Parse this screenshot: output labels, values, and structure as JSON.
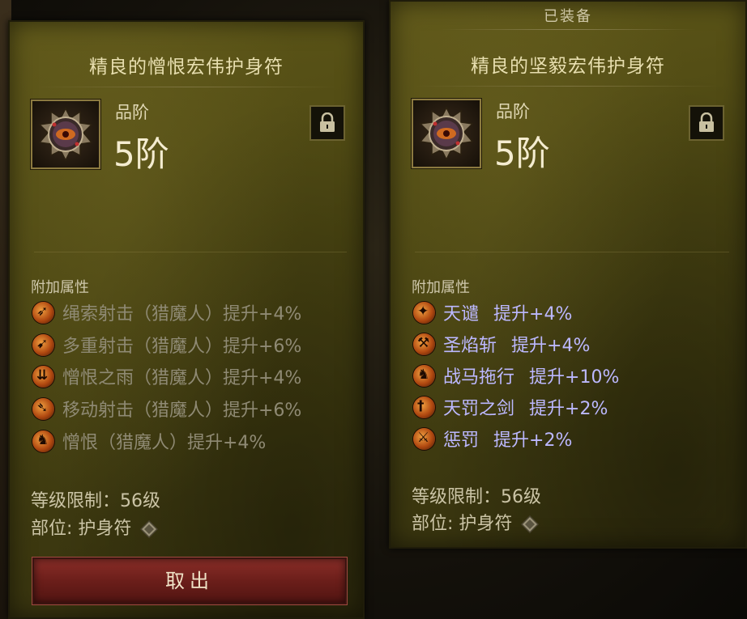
{
  "left_panel": {
    "title": "精良的憎恨宏伟护身符",
    "rank_label": "品阶",
    "rank_value": "5阶",
    "section_title": "附加属性",
    "affixes": [
      {
        "text": "绳索射击（猎魔人）提升+4%",
        "icon": "chakram-arrows-icon"
      },
      {
        "text": "多重射击（猎魔人）提升+6%",
        "icon": "multishot-icon"
      },
      {
        "text": "憎恨之雨（猎魔人）提升+4%",
        "icon": "rain-of-vengeance-icon"
      },
      {
        "text": "移动射击（猎魔人）提升+6%",
        "icon": "strafe-icon"
      },
      {
        "text": "憎恨（猎魔人）提升+4%",
        "icon": "vengeance-icon"
      }
    ],
    "level_req": "等级限制：56级",
    "slot": "部位: 护身符",
    "button_label": "取出"
  },
  "right_panel": {
    "equipped_label": "已装备",
    "title": "精良的坚毅宏伟护身符",
    "rank_label": "品阶",
    "rank_value": "5阶",
    "section_title": "附加属性",
    "affixes": [
      {
        "name": "天谴",
        "bonus": "提升+4%",
        "icon": "heavens-fury-icon"
      },
      {
        "name": "圣焰斩",
        "bonus": "提升+4%",
        "icon": "blessed-hammer-icon"
      },
      {
        "name": "战马拖行",
        "bonus": "提升+10%",
        "icon": "steed-charge-icon"
      },
      {
        "name": "天罚之剑",
        "bonus": "提升+2%",
        "icon": "sword-of-justice-icon"
      },
      {
        "name": "惩罚",
        "bonus": "提升+2%",
        "icon": "punish-icon"
      }
    ],
    "level_req": "等级限制：56级",
    "slot": "部位: 护身符"
  },
  "colors": {
    "panel": "#4b4612",
    "active_affix": "#bcb8ff",
    "inactive_affix": "#8f8a74",
    "button": "#6b1e1a"
  }
}
